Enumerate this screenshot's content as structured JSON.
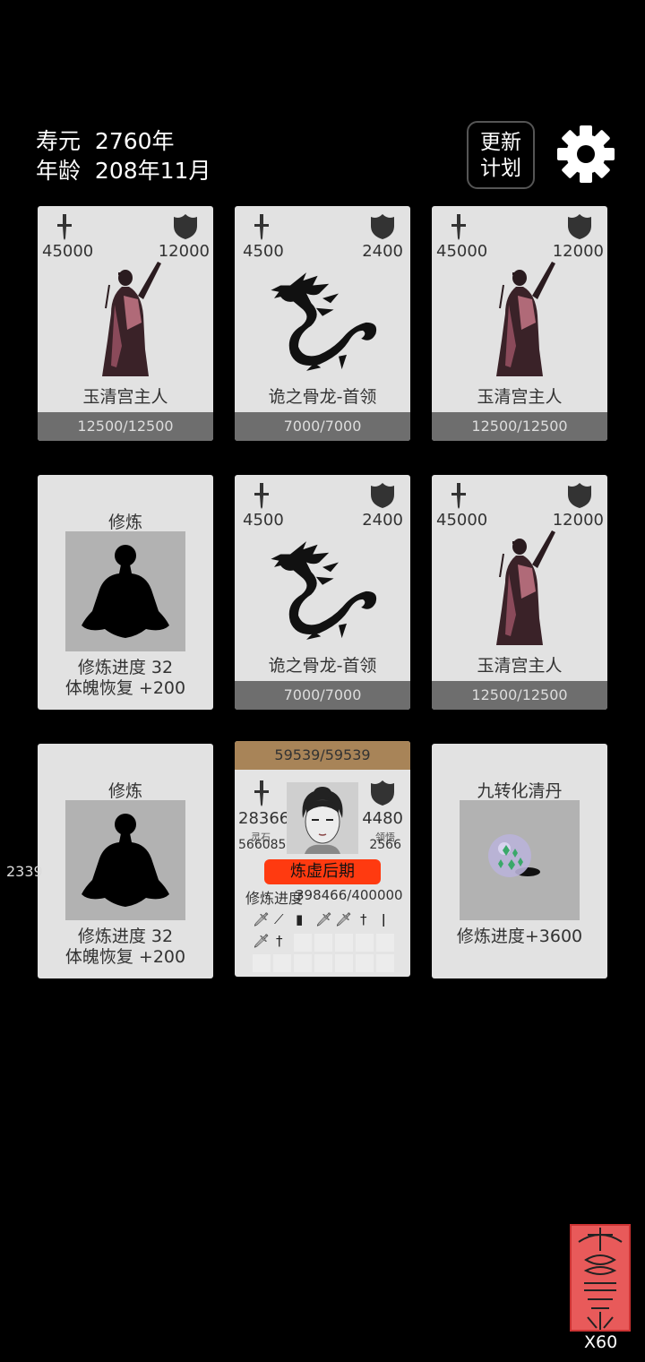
{
  "header": {
    "lifespan_label": "寿元",
    "lifespan_value": "2760年",
    "age_label": "年龄",
    "age_value": "208年11月",
    "update_plan_line1": "更新",
    "update_plan_line2": "计划"
  },
  "cards": {
    "c1": {
      "atk": "45000",
      "def": "12000",
      "name": "玉清宫主人",
      "hp": "12500/12500"
    },
    "c2": {
      "atk": "4500",
      "def": "2400",
      "name": "诡之骨龙-首领",
      "hp": "7000/7000"
    },
    "c3": {
      "atk": "45000",
      "def": "12000",
      "name": "玉清宫主人",
      "hp": "12500/12500"
    },
    "c4": {
      "title": "修炼",
      "line1": "修炼进度  32",
      "line2": "体魄恢复  +200"
    },
    "c5": {
      "atk": "4500",
      "def": "2400",
      "name": "诡之骨龙-首领",
      "hp": "7000/7000"
    },
    "c6": {
      "atk": "45000",
      "def": "12000",
      "name": "玉清宫主人",
      "hp": "12500/12500"
    },
    "c7": {
      "title": "修炼",
      "line1": "修炼进度  32",
      "line2": "体魄恢复  +200"
    },
    "c8": {
      "hp": "59539/59539",
      "atk": "28366",
      "def": "4480",
      "stone_label": "灵石",
      "stone_value": "566085",
      "insight_label": "领悟",
      "insight_value": "2566",
      "realm": "炼虚后期",
      "progress_label": "修炼进度",
      "progress_value": "398466/400000"
    },
    "c9": {
      "title": "九转化清丹",
      "line": "修炼进度+3600"
    }
  },
  "side_number": "2339",
  "talisman": {
    "count": "X60"
  },
  "colors": {
    "background": "#000000",
    "card": "#e2e2e2",
    "hp_bar": "#6e6e6e",
    "player_hp_bar": "#a88458",
    "realm_badge": "#ff3a10"
  },
  "icons": [
    "sword-icon",
    "shield-icon",
    "gear-icon",
    "meditation-icon",
    "dragon-icon",
    "cultivator-icon",
    "pill-icon",
    "talisman-icon"
  ]
}
